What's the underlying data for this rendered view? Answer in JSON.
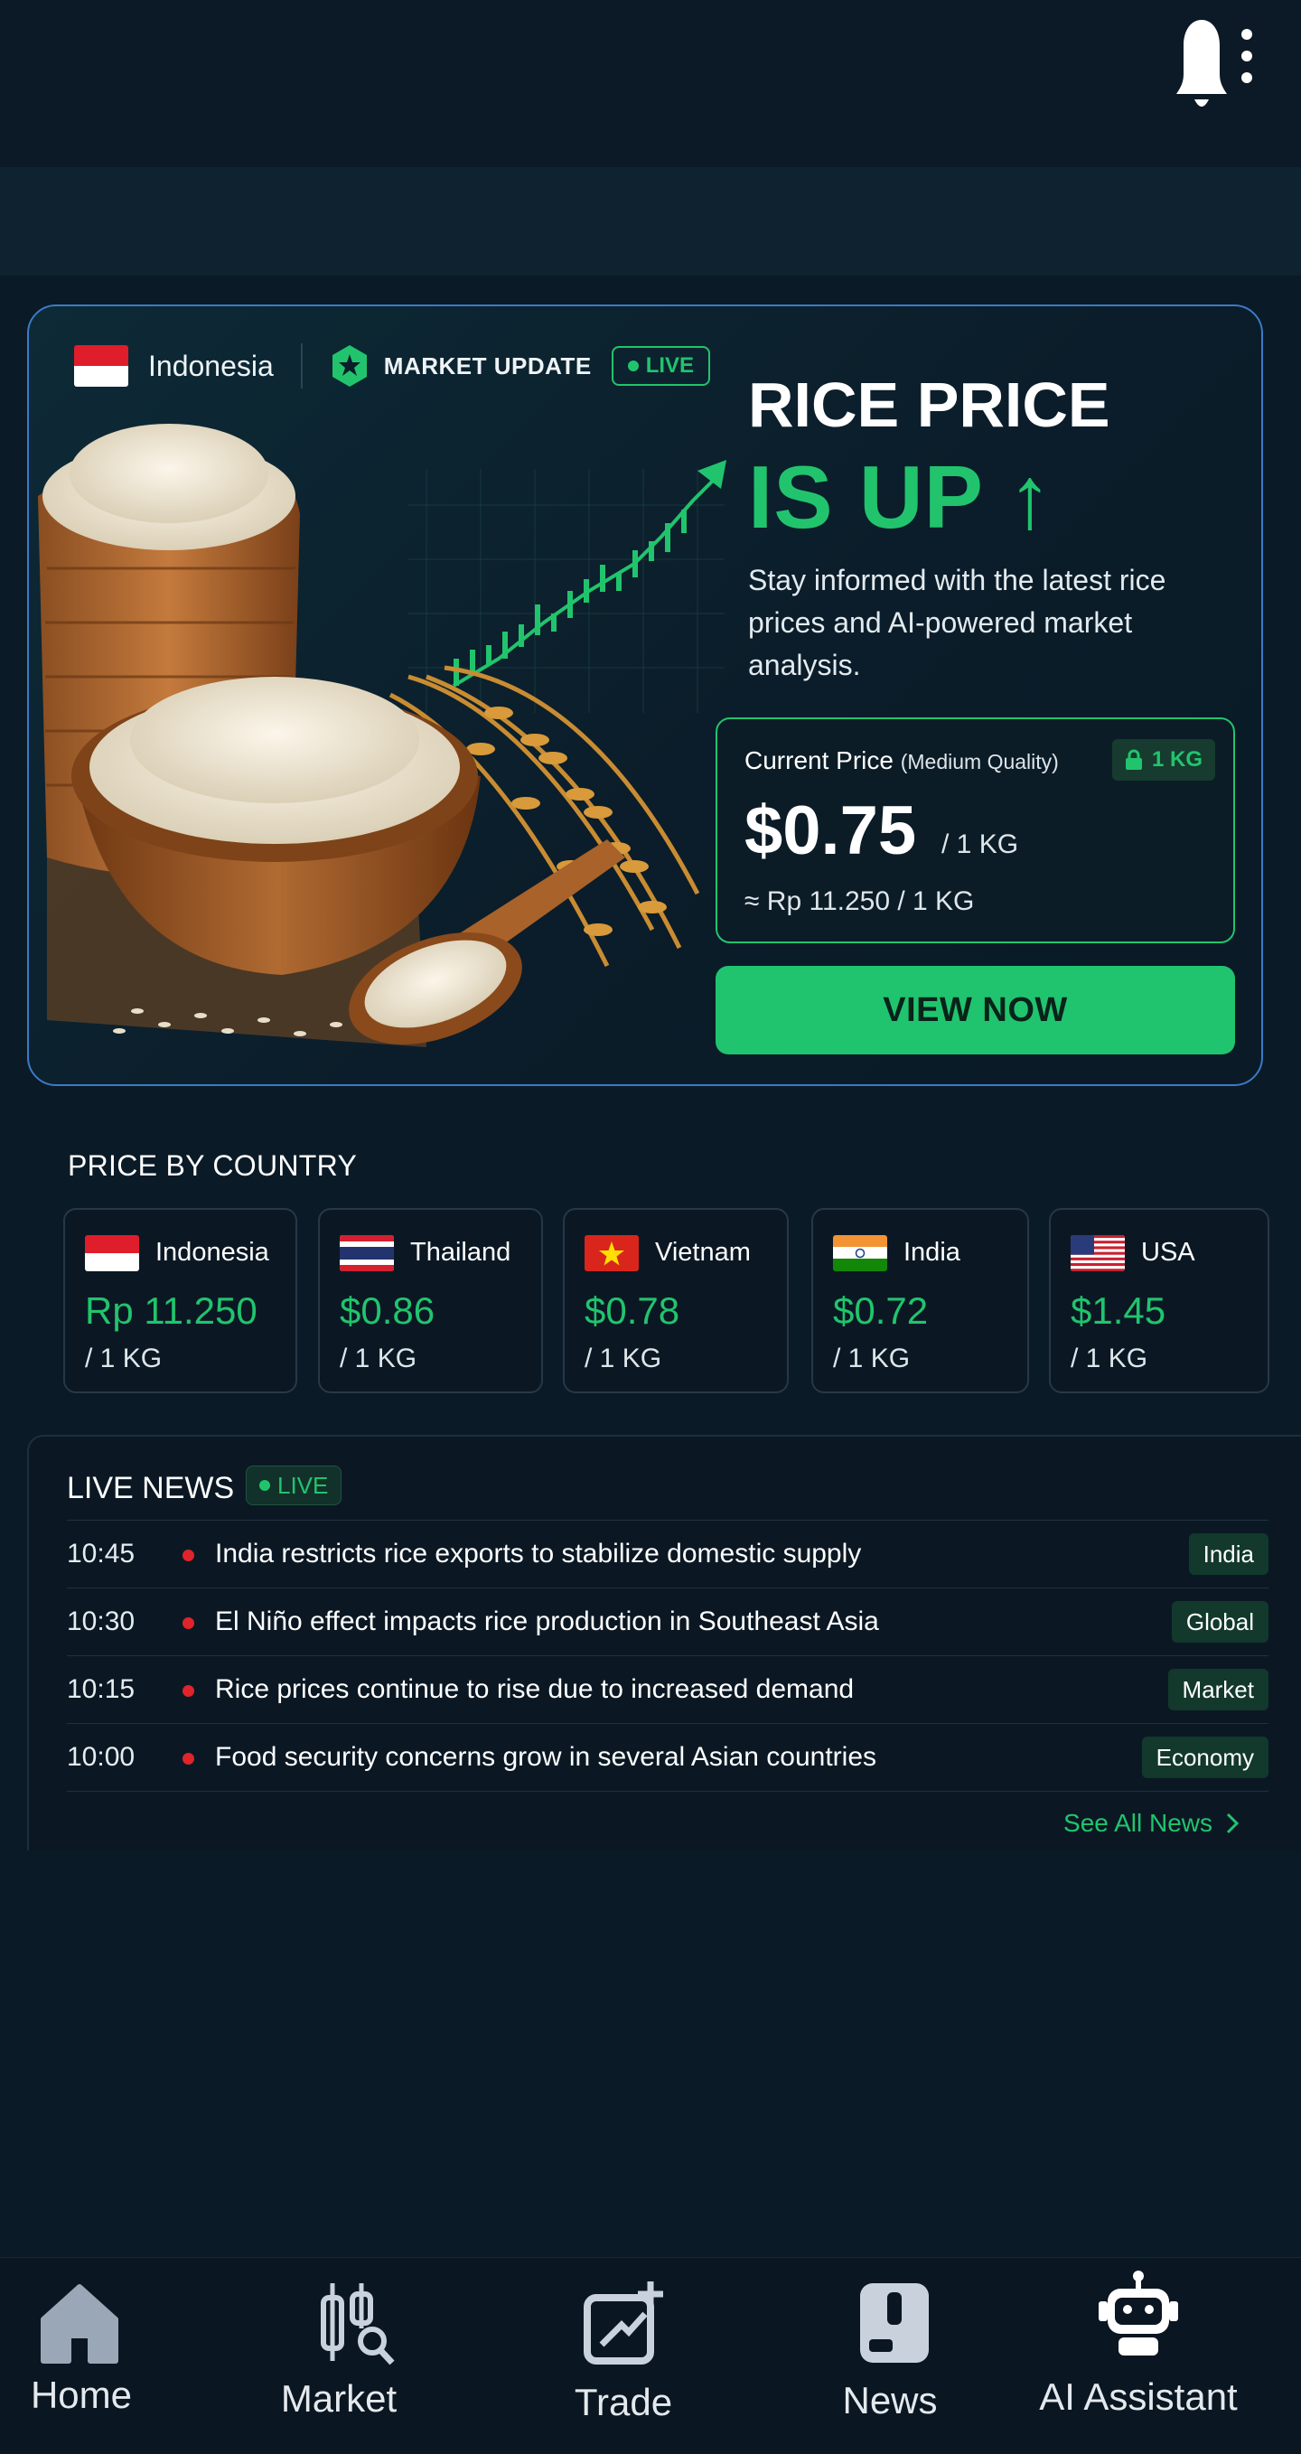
{
  "colors": {
    "accent_green": "#21c46d",
    "background": "#0b1a27",
    "border_blue": "#3a7bc8",
    "news_dot_red": "#e0242c"
  },
  "header": {
    "notification_icon": "bell-icon",
    "menu_icon": "kebab-menu-icon"
  },
  "hero": {
    "country": "Indonesia",
    "market_update_label": "MARKET UPDATE",
    "live_label": "LIVE",
    "title_line1": "RICE PRICE",
    "title_line2": "IS UP ↑",
    "description": "Stay informed with the latest rice prices and AI-powered market analysis.",
    "current_price": {
      "label": "Current Price",
      "quality": "(Medium Quality)",
      "badge": "1 KG",
      "price": "$0.75",
      "unit": "/ 1 KG",
      "converted": "≈ Rp 11.250 / 1 KG"
    },
    "cta_label": "VIEW NOW"
  },
  "price_by_country": {
    "title": "PRICE BY COUNTRY",
    "items": [
      {
        "country": "Indonesia",
        "price": "Rp 11.250",
        "unit": "/ 1 KG"
      },
      {
        "country": "Thailand",
        "price": "$0.86",
        "unit": "/ 1 KG"
      },
      {
        "country": "Vietnam",
        "price": "$0.78",
        "unit": "/ 1 KG"
      },
      {
        "country": "India",
        "price": "$0.72",
        "unit": "/ 1 KG"
      },
      {
        "country": "USA",
        "price": "$1.45",
        "unit": "/ 1 KG"
      }
    ]
  },
  "live_news": {
    "title": "LIVE NEWS",
    "live_label": "LIVE",
    "items": [
      {
        "time": "10:45",
        "headline": "India restricts rice exports to stabilize domestic supply",
        "tag": "India"
      },
      {
        "time": "10:30",
        "headline": "El Niño effect impacts rice production in Southeast Asia",
        "tag": "Global"
      },
      {
        "time": "10:15",
        "headline": "Rice prices continue to rise due to increased demand",
        "tag": "Market"
      },
      {
        "time": "10:00",
        "headline": "Food security concerns grow in several Asian countries",
        "tag": "Economy"
      }
    ],
    "see_all_label": "See All News"
  },
  "bottom_nav": {
    "items": [
      {
        "label": "Home",
        "icon": "home-icon"
      },
      {
        "label": "Market",
        "icon": "market-icon"
      },
      {
        "label": "Trade",
        "icon": "trade-icon"
      },
      {
        "label": "News",
        "icon": "news-icon"
      },
      {
        "label": "AI Assistant",
        "icon": "robot-icon"
      }
    ]
  }
}
